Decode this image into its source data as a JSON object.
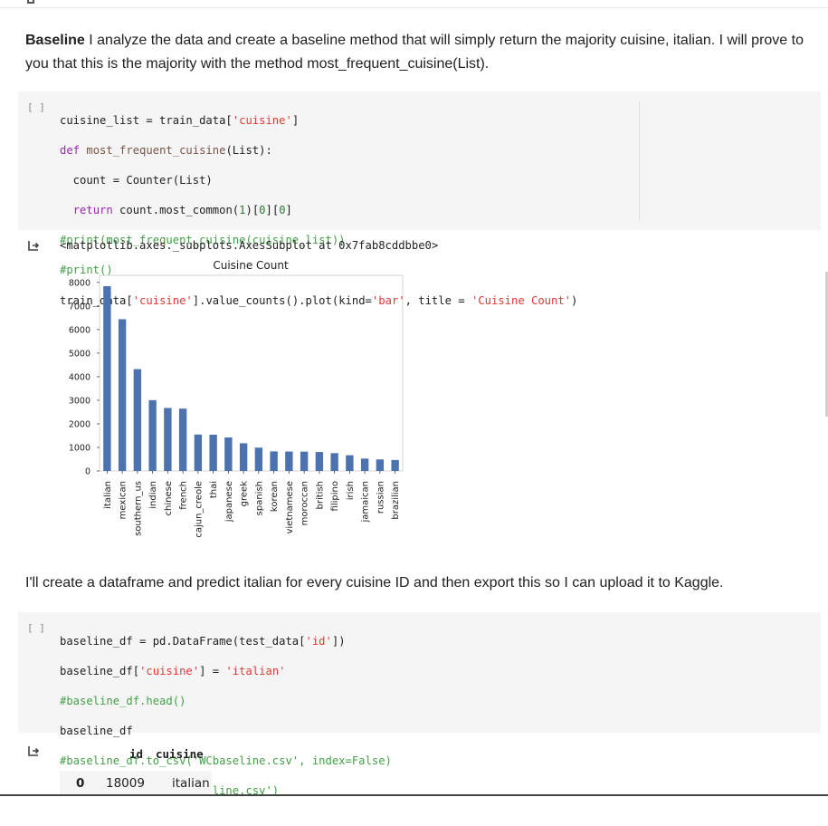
{
  "markdown1": {
    "bold": "Baseline",
    "text": " I analyze the data and create a baseline method that will simply return the majority cuisine, italian. I will prove to you that this is the majority with the method most_frequent_cuisine(List)."
  },
  "cell1": {
    "prompt": "[ ]",
    "output_repr": "<matplotlib.axes._subplots.AxesSubplot at 0x7fab8cddbbe0>"
  },
  "markdown2": {
    "text": "I'll create a dataframe and predict italian for every cuisine ID and then export this so I can upload it to Kaggle."
  },
  "cell2": {
    "prompt": "[ ]"
  },
  "dataframe": {
    "columns": [
      "id",
      "cuisine"
    ],
    "rows": [
      {
        "index": "0",
        "id": "18009",
        "cuisine": "italian"
      }
    ]
  },
  "icons": {
    "output": "output-arrow-icon"
  },
  "chart_data": {
    "type": "bar",
    "title": "Cuisine Count",
    "xlabel": "",
    "ylabel": "",
    "ylim": [
      0,
      8300
    ],
    "yticks": [
      0,
      1000,
      2000,
      3000,
      4000,
      5000,
      6000,
      7000,
      8000
    ],
    "categories": [
      "italian",
      "mexican",
      "southern_us",
      "indian",
      "chinese",
      "french",
      "cajun_creole",
      "thai",
      "japanese",
      "greek",
      "spanish",
      "korean",
      "vietnamese",
      "moroccan",
      "british",
      "filipino",
      "irish",
      "jamaican",
      "russian",
      "brazilian"
    ],
    "values": [
      7838,
      6438,
      4320,
      3003,
      2673,
      2646,
      1546,
      1539,
      1423,
      1175,
      989,
      830,
      825,
      821,
      804,
      755,
      667,
      526,
      489,
      467
    ],
    "bar_color": "#4c72b0",
    "grid": false
  }
}
